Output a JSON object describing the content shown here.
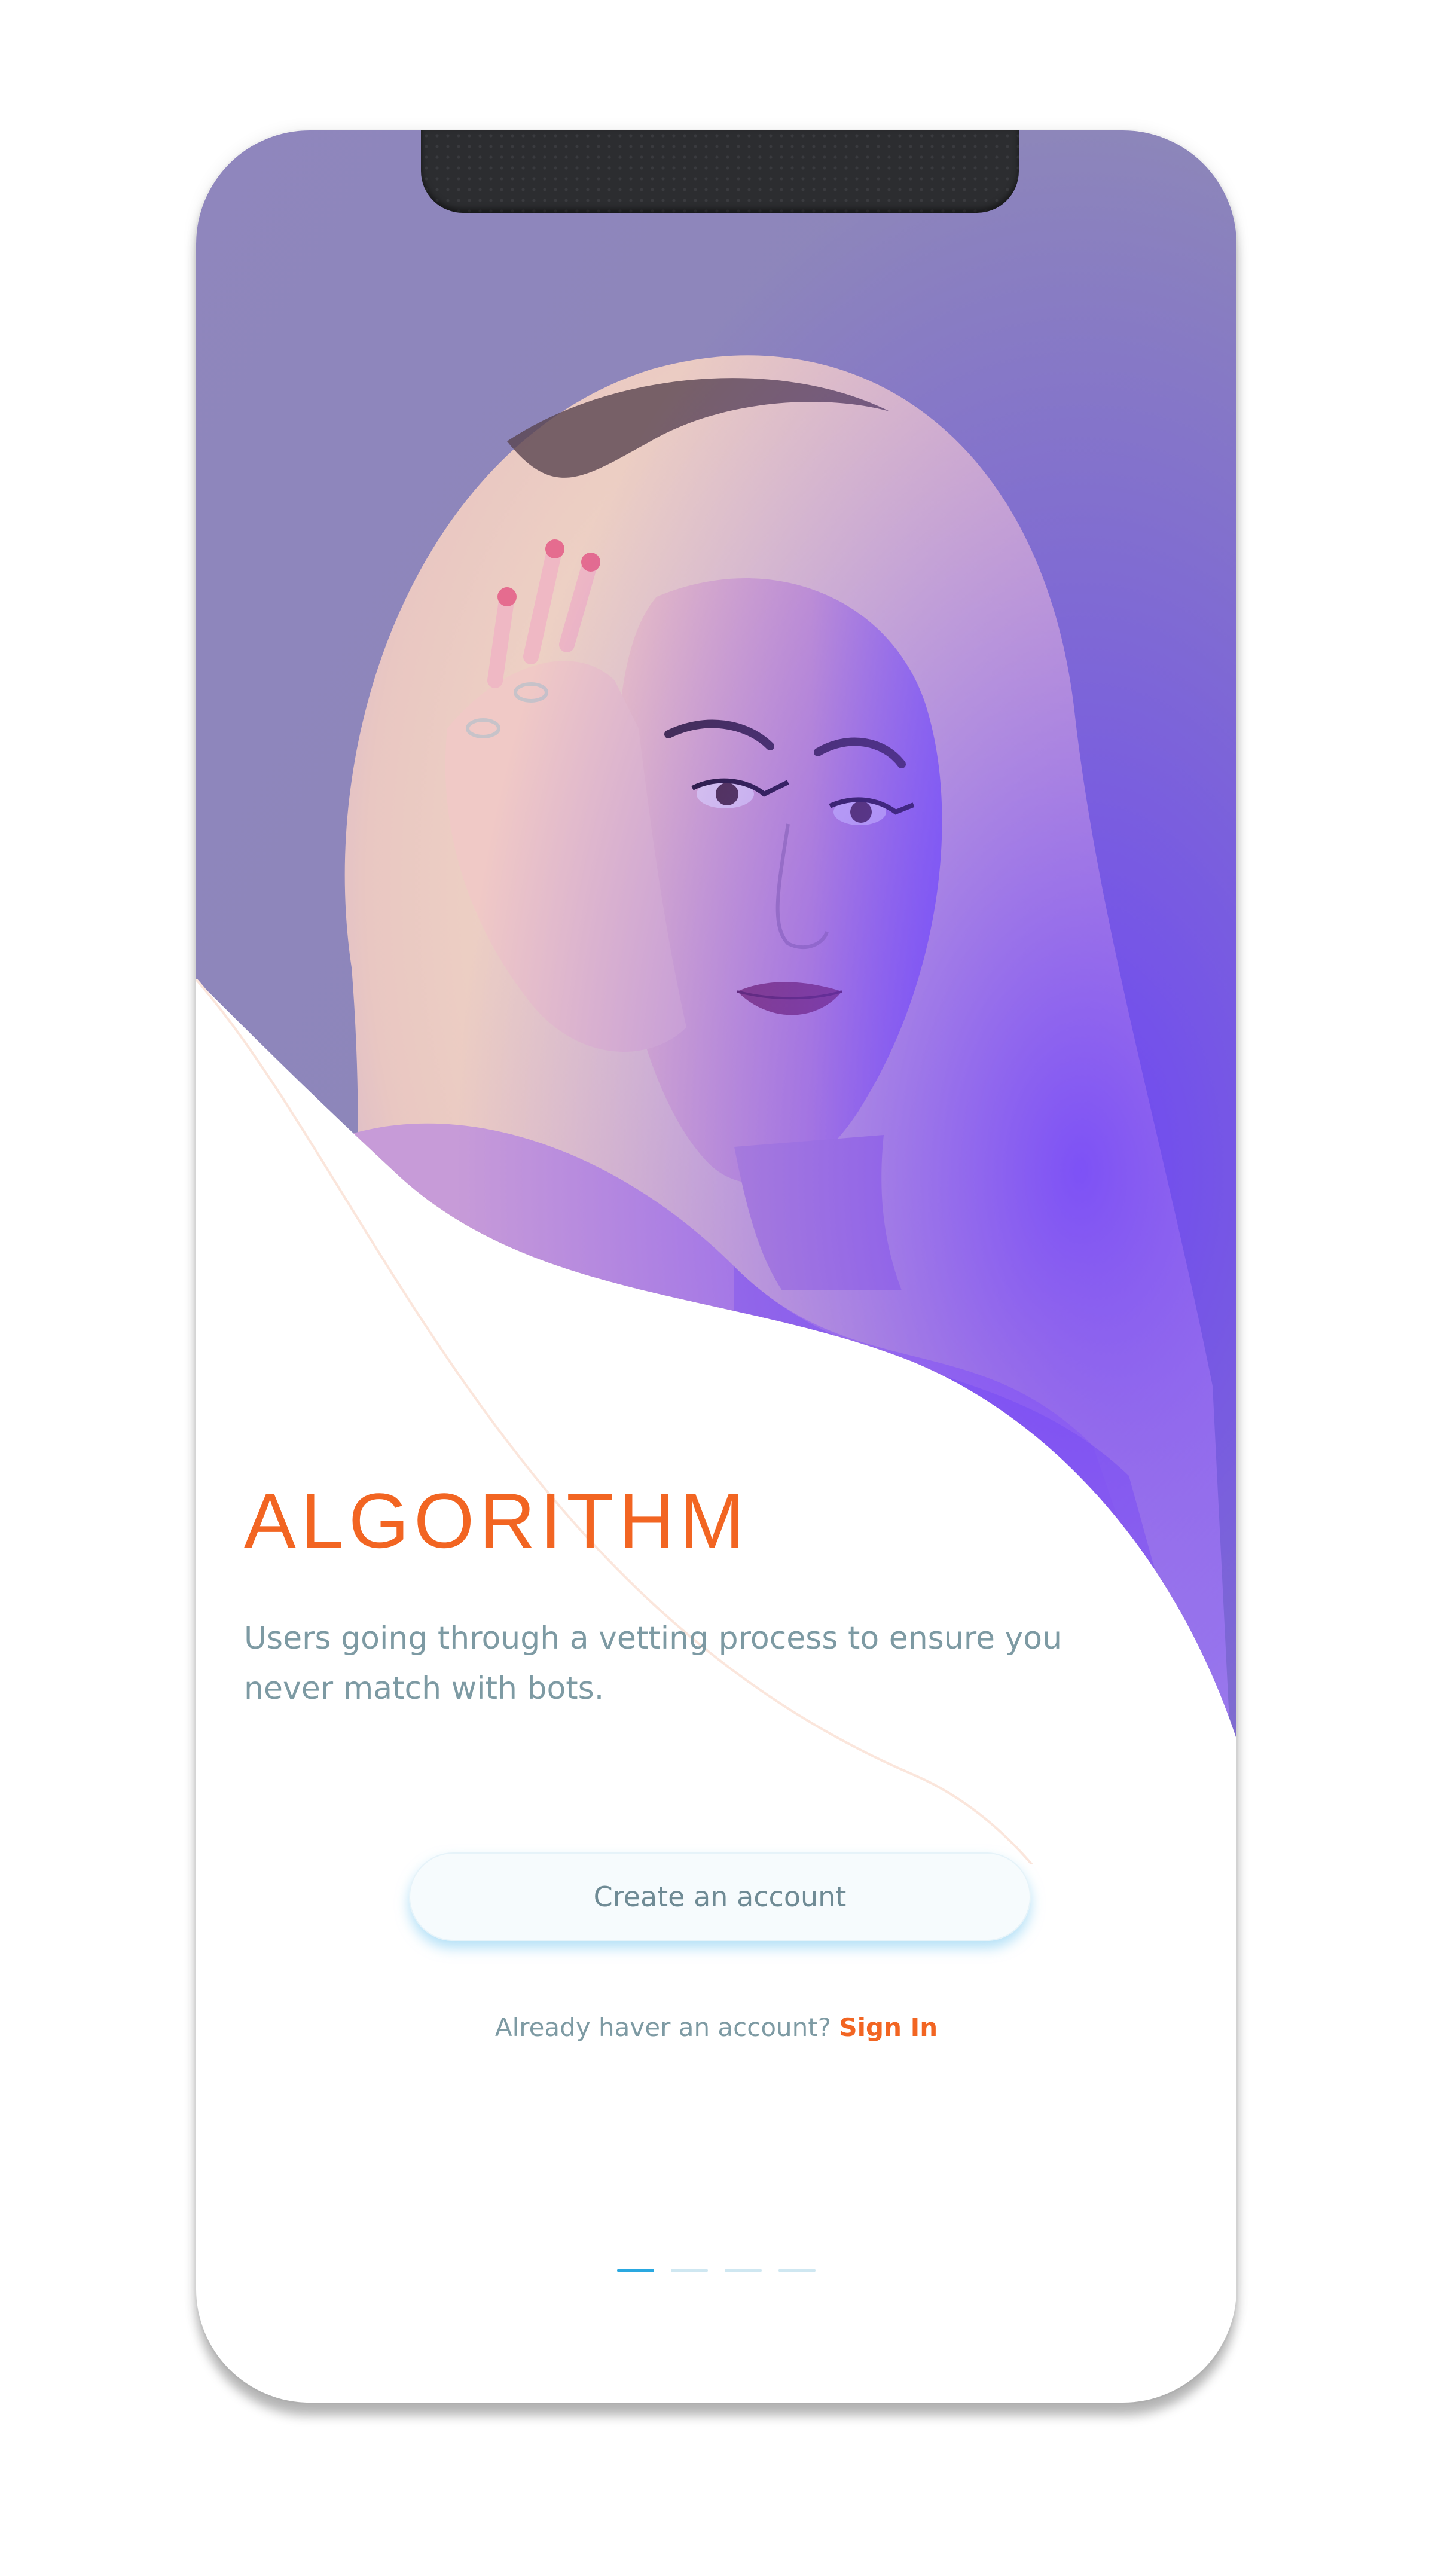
{
  "app": {
    "brand": "ALGORITHM"
  },
  "hero": {
    "image_label": "portrait-photo"
  },
  "onboarding": {
    "tagline": "Users going through a vetting process to ensure you never match with bots.",
    "create_account_label": "Create an account",
    "signin_prompt": "Already haver an account?",
    "signin_label": "Sign In",
    "page_count": 4,
    "active_page": 1
  },
  "colors": {
    "accent": "#f26522",
    "text_muted": "#7d9aa3",
    "indicator_active": "#2aa8e0",
    "indicator_inactive": "#cfe7f1",
    "button_glow": "#7cc8f0",
    "hero_purple": "#7b5cf0"
  },
  "icons": {
    "notch": "device-notch"
  }
}
